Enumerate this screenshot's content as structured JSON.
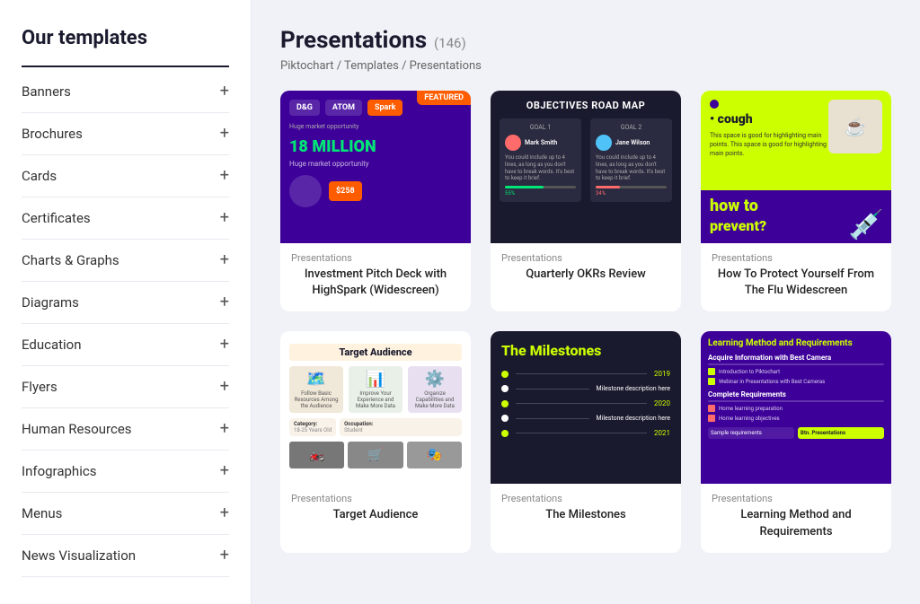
{
  "sidebar": {
    "title": "Our templates",
    "items": [
      {
        "label": "Banners",
        "icon": "+"
      },
      {
        "label": "Brochures",
        "icon": "+"
      },
      {
        "label": "Cards",
        "icon": "+"
      },
      {
        "label": "Certificates",
        "icon": "+"
      },
      {
        "label": "Charts & Graphs",
        "icon": "+"
      },
      {
        "label": "Diagrams",
        "icon": "+"
      },
      {
        "label": "Education",
        "icon": "+"
      },
      {
        "label": "Flyers",
        "icon": "+"
      },
      {
        "label": "Human Resources",
        "icon": "+"
      },
      {
        "label": "Infographics",
        "icon": "+"
      },
      {
        "label": "Menus",
        "icon": "+"
      },
      {
        "label": "News Visualization",
        "icon": "+"
      }
    ]
  },
  "main": {
    "page_title": "Presentations",
    "page_count": "(146)",
    "breadcrumb": "Piktochart / Templates / Presentations",
    "templates": [
      {
        "id": "card1",
        "category": "Presentations",
        "name": "Investment Pitch Deck with HighSpark (Widescreen)",
        "badge": "FEATURED"
      },
      {
        "id": "card2",
        "category": "Presentations",
        "name": "Quarterly OKRs Review"
      },
      {
        "id": "card3",
        "category": "Presentations",
        "name": "How To Protect Yourself From The Flu Widescreen"
      },
      {
        "id": "card4",
        "category": "Presentations",
        "name": "Target Audience"
      },
      {
        "id": "card5",
        "category": "Presentations",
        "name": "The Milestones"
      },
      {
        "id": "card6",
        "category": "Presentations",
        "name": "Learning Method and Requirements"
      }
    ]
  }
}
